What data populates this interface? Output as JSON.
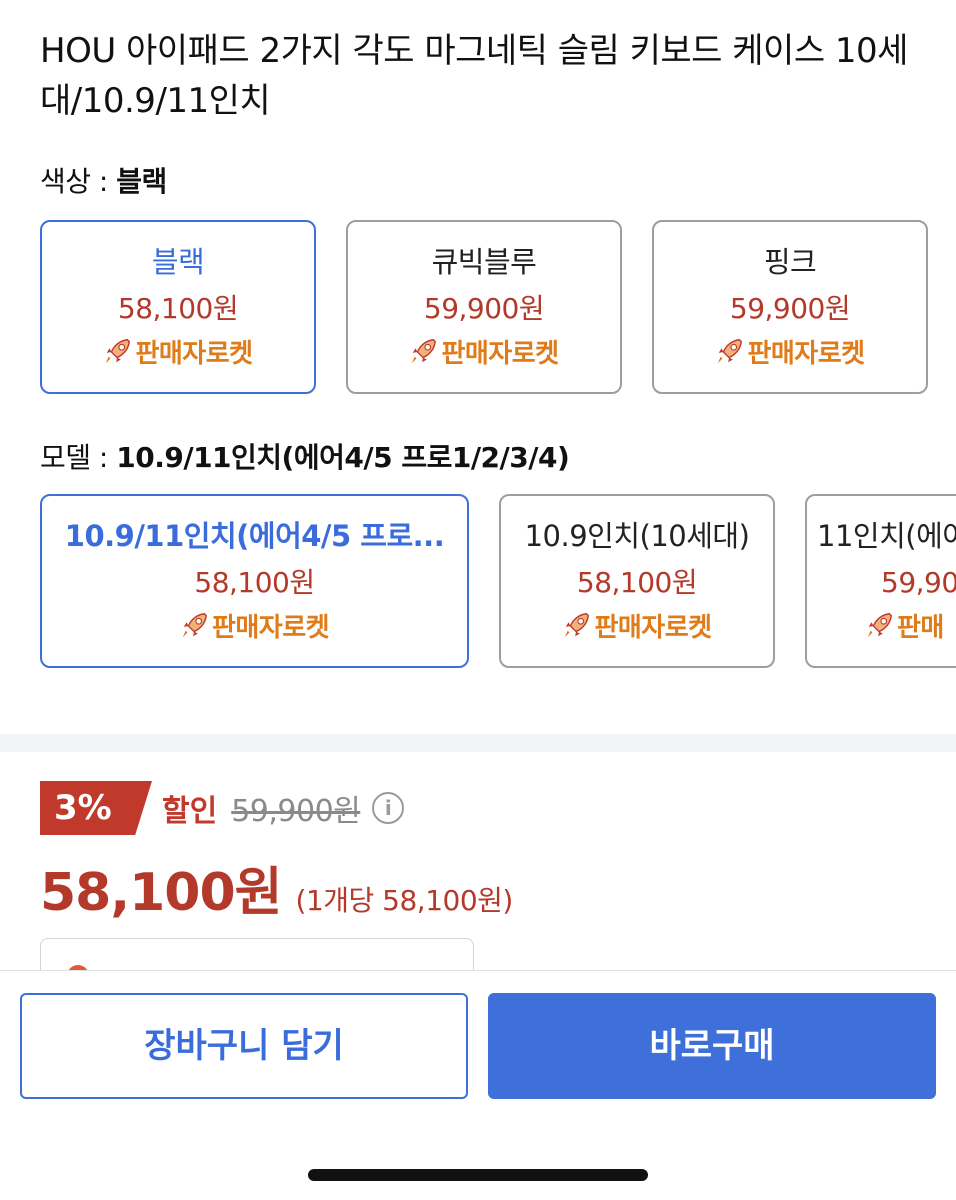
{
  "product": {
    "title": "HOU 아이패드 2가지 각도 마그네틱 슬림 키보드 케이스 10세대/10.9/11인치"
  },
  "color_option": {
    "label": "색상 : ",
    "selected": "블랙",
    "items": [
      {
        "name": "블랙",
        "price": "58,100원",
        "badge": "판매자로켓"
      },
      {
        "name": "큐빅블루",
        "price": "59,900원",
        "badge": "판매자로켓"
      },
      {
        "name": "핑크",
        "price": "59,900원",
        "badge": "판매자로켓"
      }
    ]
  },
  "model_option": {
    "label": "모델 : ",
    "selected": "10.9/11인치(에어4/5 프로1/2/3/4)",
    "items": [
      {
        "name": "10.9/11인치(에어4/5 프로...",
        "price": "58,100원",
        "badge": "판매자로켓"
      },
      {
        "name": "10.9인치(10세대)",
        "price": "58,100원",
        "badge": "판매자로켓"
      },
      {
        "name": "11인치(에어",
        "price": "59,90",
        "badge": "판매"
      }
    ]
  },
  "pricing": {
    "discount_rate": "3%",
    "discount_word": "할인",
    "original_price": "59,900원",
    "info_symbol": "i",
    "final_price": "58,100원",
    "unit_price": "(1개당 58,100원)"
  },
  "actions": {
    "cart": "장바구니 담기",
    "buy": "바로구매"
  },
  "icons": {
    "badge": "rocket-icon",
    "info": "info-icon"
  },
  "colors": {
    "accent": "#3f6fd8",
    "price_red": "#b33a2a",
    "badge_orange": "#e07b1a",
    "discount_red": "#c0392b"
  }
}
